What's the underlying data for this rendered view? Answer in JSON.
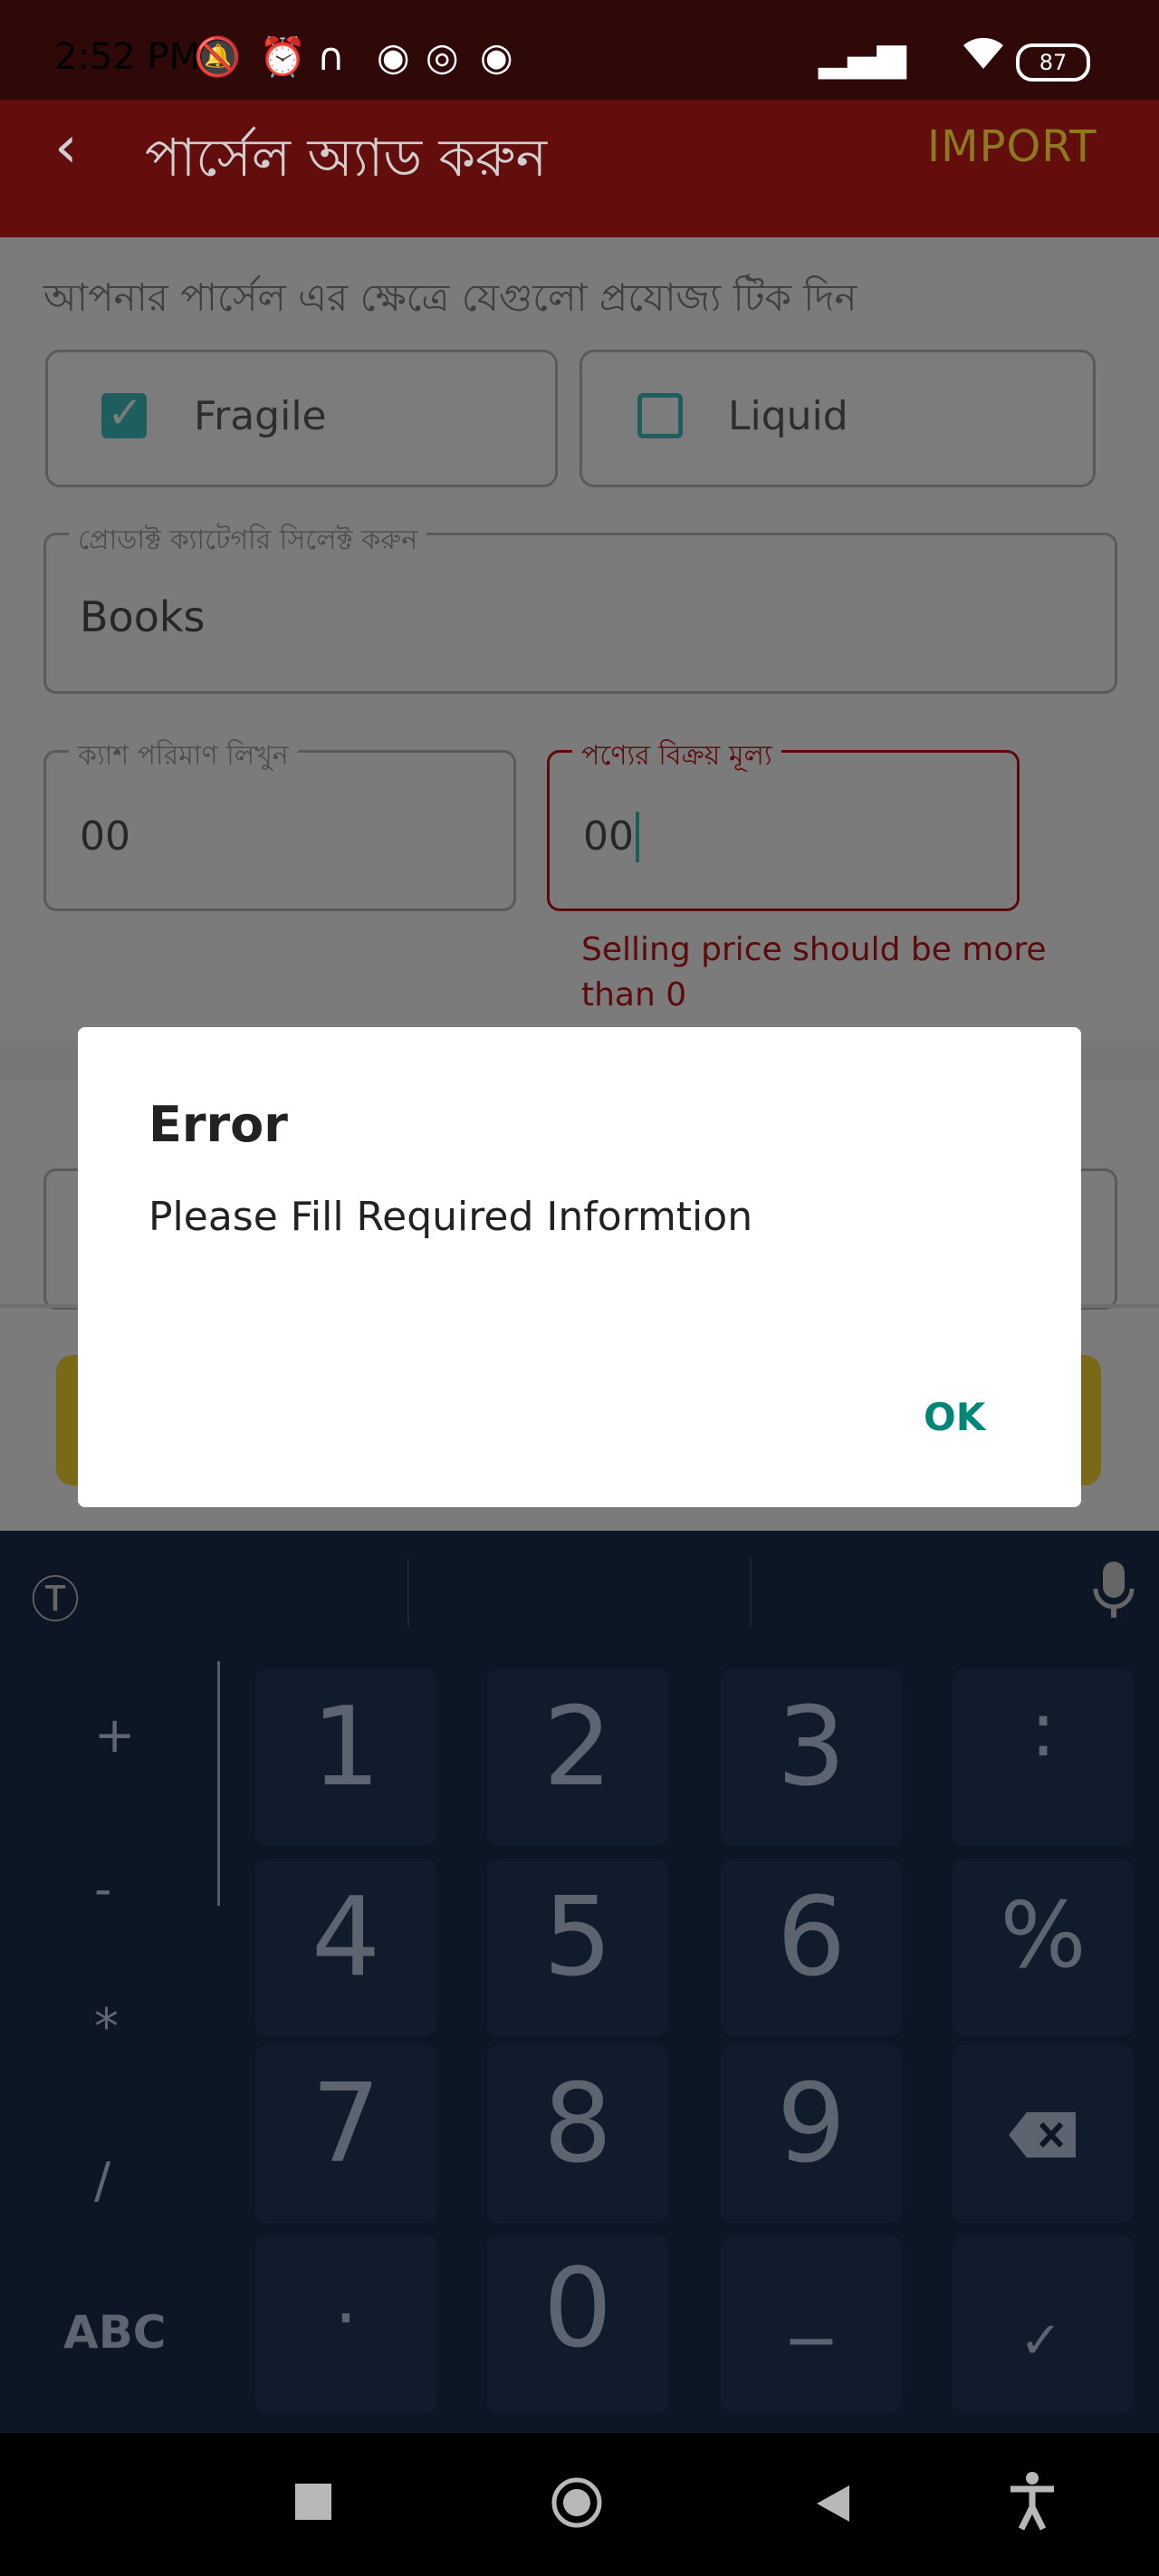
{
  "status_bar": {
    "time": "2:52 PM",
    "icons": [
      "mute-icon",
      "alarm-icon",
      "headset-icon",
      "messenger-icon",
      "whatsapp-icon",
      "messenger-icon",
      "signal-icon",
      "signal-icon",
      "wifi-icon"
    ],
    "battery": "87"
  },
  "app_bar": {
    "title": "পার্সেল অ্যাড করুন",
    "import_label": "IMPORT"
  },
  "form": {
    "instruction": "আপনার পার্সেল এর ক্ষেত্রে যেগুলো প্রযোজ্য টিক দিন",
    "fragile_label": "Fragile",
    "liquid_label": "Liquid",
    "category_label": "প্রোডাক্ট ক্যাটেগরি সিলেক্ট করুন",
    "category_value": "Books",
    "cash_label": "ক্যাশ পরিমাণ লিখুন",
    "cash_value": "00",
    "price_label": "পণ্যের বিক্রয় মূল্য",
    "price_value": "00",
    "price_error": "Selling price should be more than 0"
  },
  "dialog": {
    "title": "Error",
    "message": "Please Fill Required Informtion",
    "ok_label": "OK"
  },
  "keyboard": {
    "symbols": [
      "+",
      "-",
      "*",
      "/"
    ],
    "numbers": [
      "1",
      "2",
      "3",
      "4",
      "5",
      "6",
      "7",
      "8",
      "9"
    ],
    "right_keys": [
      ":",
      "%"
    ],
    "zero": "0",
    "dot": ".",
    "underscore": "_",
    "abc_label": "ABC"
  },
  "colors": {
    "accent_teal": "#008577",
    "error_red": "#5c0a0a",
    "appbar_red": "#640d0d"
  }
}
